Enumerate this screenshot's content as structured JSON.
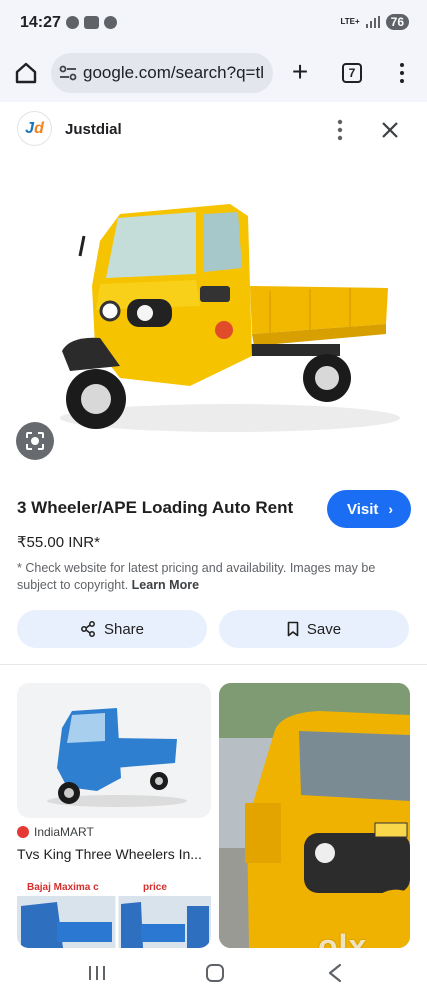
{
  "status_bar": {
    "time": "14:27",
    "network": "LTE+",
    "battery": "76"
  },
  "browser": {
    "url": "google.com/search?q=tl",
    "tab_count": "7"
  },
  "source": {
    "logo_text_j": "J",
    "logo_text_d": "d",
    "name": "Justdial"
  },
  "result": {
    "title": "3 Wheeler/APE Loading Auto Rent",
    "visit_label": "Visit",
    "price": "₹55.00 INR*",
    "disclaimer": "* Check website for latest pricing and availability. Images may be subject to copyright.",
    "learn_more": "Learn More",
    "share_label": "Share",
    "save_label": "Save"
  },
  "related": [
    {
      "source": "IndiaMART",
      "title": "Tvs King Three Wheelers In..."
    },
    {
      "banner_left": "Bajaj Maxima c",
      "banner_right": "price"
    }
  ],
  "watermark": "olx",
  "colors": {
    "accent": "#1b6ef3",
    "chip_bg": "#e8f0fe",
    "vehicle_yellow": "#f5c300",
    "vehicle_blue": "#2f7fd0"
  }
}
